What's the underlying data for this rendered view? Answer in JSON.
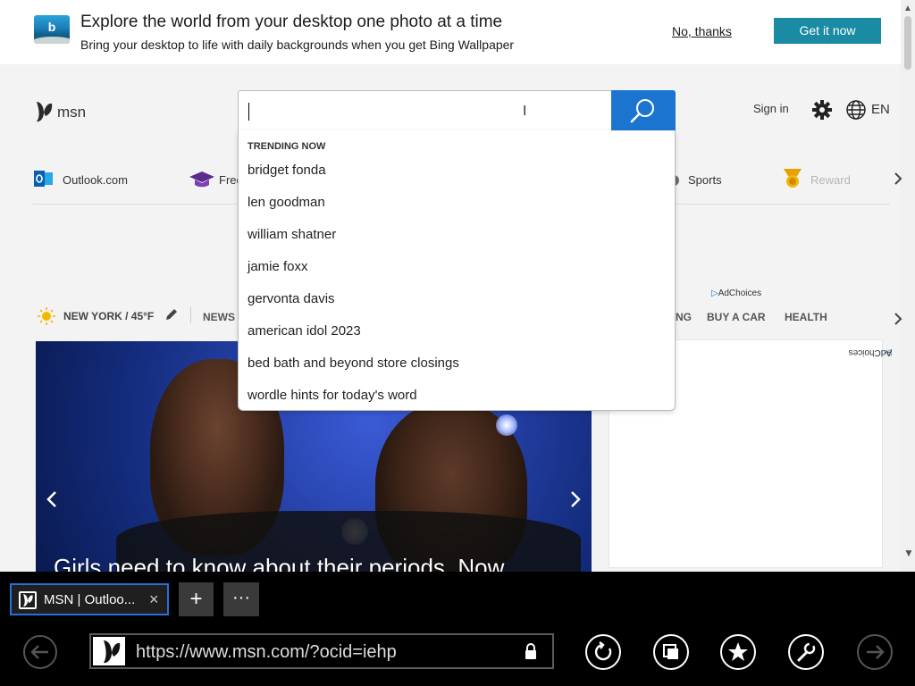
{
  "promo": {
    "title": "Explore the world from your desktop one photo at a time",
    "subtitle": "Bring your desktop to life with daily backgrounds when you get Bing Wallpaper",
    "no_thanks": "No, thanks",
    "get_it": "Get it now"
  },
  "header": {
    "logo_text": "msn",
    "search_value": "",
    "sign_in": "Sign in",
    "language": "EN"
  },
  "quick_links": [
    {
      "label": "Outlook.com",
      "icon": "outlook-icon"
    },
    {
      "label": "Free",
      "icon": "graduation-cap-icon"
    },
    {
      "label": "Sports",
      "icon": "sports-icon"
    },
    {
      "label": "Reward",
      "icon": "rewards-medal-icon"
    }
  ],
  "ad_choices": "AdChoices",
  "weather": "NEW YORK / 45°F",
  "nav": [
    "NEWS",
    "NG",
    "BUY A CAR",
    "HEALTH"
  ],
  "hero": {
    "title": "Girls need to know about their periods. Now"
  },
  "suggestions": {
    "heading": "TRENDING NOW",
    "items": [
      "bridget fonda",
      "len goodman",
      "william shatner",
      "jamie foxx",
      "gervonta davis",
      "american idol 2023",
      "bed bath and beyond store closings",
      "wordle hints for today's word"
    ]
  },
  "browser": {
    "tab_title": "MSN | Outloo...",
    "tab_close": "×",
    "new_tab": "+",
    "tab_menu": "···",
    "url": "https://www.msn.com/?ocid=iehp"
  },
  "colors": {
    "search_button": "#1b75d0",
    "get_it_button": "#1a8ba2",
    "tab_border": "#2b6ed9"
  }
}
